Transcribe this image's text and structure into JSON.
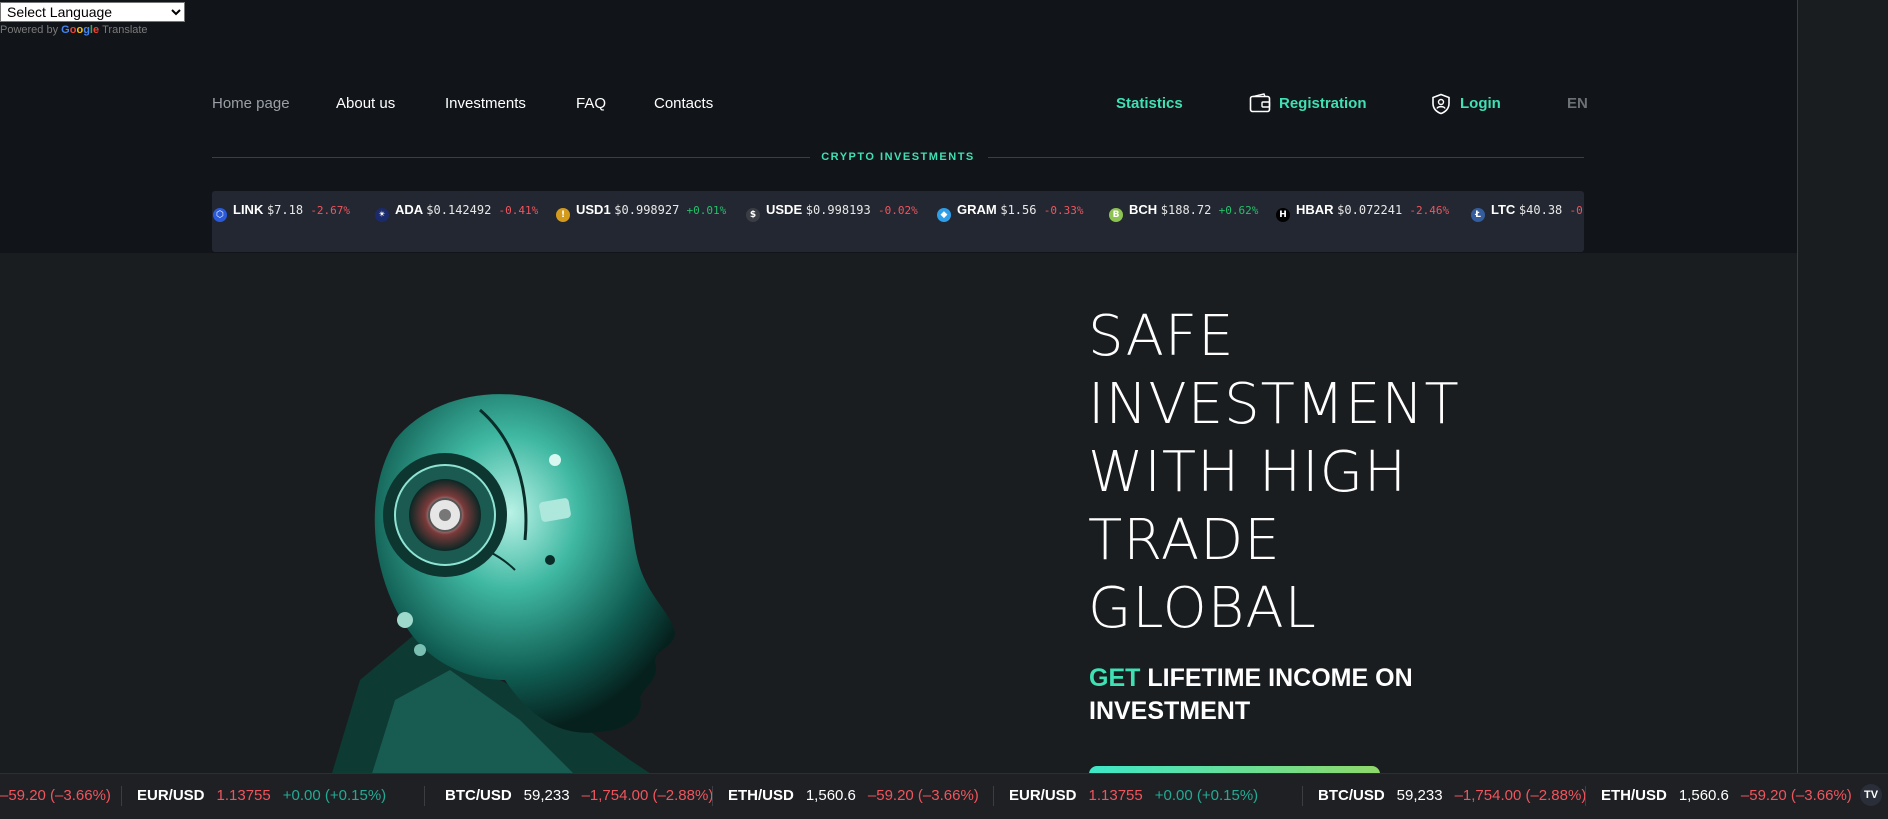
{
  "translate": {
    "select_label": "Select Language",
    "powered_by": "Powered by",
    "google": "Google",
    "translate": "Translate"
  },
  "nav": {
    "home": "Home page",
    "about": "About us",
    "investments": "Investments",
    "faq": "FAQ",
    "contacts": "Contacts",
    "statistics": "Statistics",
    "registration": "Registration",
    "login": "Login",
    "language": "EN"
  },
  "section_label": "CRYPTO INVESTMENTS",
  "crypto_ticker": [
    {
      "symbol": "LINK",
      "price": "$7.18",
      "change": "-2.67%",
      "dir": "neg",
      "icon": "chainlink-icon",
      "color": "#2a5ada"
    },
    {
      "symbol": "ADA",
      "price": "$0.142492",
      "change": "-0.41%",
      "dir": "neg",
      "icon": "cardano-icon",
      "color": "#1b2a6b"
    },
    {
      "symbol": "USD1",
      "price": "$0.998927",
      "change": "+0.01%",
      "dir": "pos",
      "icon": "usd1-icon",
      "color": "#d39a1c"
    },
    {
      "symbol": "USDE",
      "price": "$0.998193",
      "change": "-0.02%",
      "dir": "neg",
      "icon": "usde-icon",
      "color": "#3a3d44"
    },
    {
      "symbol": "GRAM",
      "price": "$1.56",
      "change": "-0.33%",
      "dir": "neg",
      "icon": "gram-icon",
      "color": "#2f9ee8"
    },
    {
      "symbol": "BCH",
      "price": "$188.72",
      "change": "+0.62%",
      "dir": "pos",
      "icon": "bitcoin-cash-icon",
      "color": "#8dc351"
    },
    {
      "symbol": "HBAR",
      "price": "$0.072241",
      "change": "-2.46%",
      "dir": "neg",
      "icon": "hedera-icon",
      "color": "#000000"
    },
    {
      "symbol": "LTC",
      "price": "$40.38",
      "change": "-0.",
      "dir": "neg",
      "icon": "litecoin-icon",
      "color": "#345d9d"
    }
  ],
  "hero": {
    "title_lines": [
      "SAFE",
      "INVESTMENT",
      "WITH HIGH",
      "TRADE",
      "GLOBAL"
    ],
    "subtitle_highlight": "GET",
    "subtitle_rest": " LIFETIME INCOME ON INVESTMENT"
  },
  "fx_ticker": [
    {
      "pair": "",
      "price": "",
      "change": "–59.20 (–3.66%)",
      "dir": "neg"
    },
    {
      "pair": "EUR/USD",
      "price": "1.13755",
      "price_red": true,
      "change": "+0.00 (+0.15%)",
      "dir": "pos"
    },
    {
      "pair": "BTC/USD",
      "price": "59,233",
      "price_red": false,
      "change": "–1,754.00 (–2.88%)",
      "dir": "neg"
    },
    {
      "pair": "ETH/USD",
      "price": "1,560.6",
      "price_red": false,
      "change": "–59.20 (–3.66%)",
      "dir": "neg"
    },
    {
      "pair": "EUR/USD",
      "price": "1.13755",
      "price_red": true,
      "change": "+0.00 (+0.15%)",
      "dir": "pos"
    },
    {
      "pair": "BTC/USD",
      "price": "59,233",
      "price_red": false,
      "change": "–1,754.00 (–2.88%)",
      "dir": "neg"
    },
    {
      "pair": "ETH/USD",
      "price": "1,560.6",
      "price_red": false,
      "change": "–59.20 (–3.66%)",
      "dir": "neg"
    }
  ],
  "tradingview_logo": "TV"
}
